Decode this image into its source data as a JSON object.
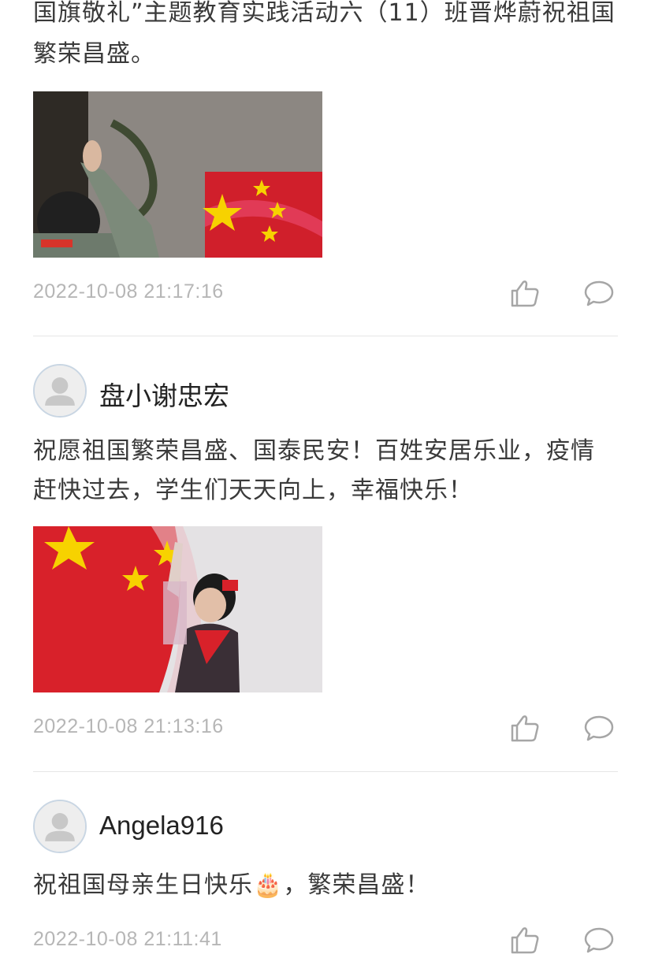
{
  "comments": [
    {
      "text_line1": "国旗敬礼”主题教育实践活动六（11）班晋烨蔚祝祖国",
      "text_line2": "繁荣昌盛。",
      "time": "2022-10-08 21:17:16",
      "photo_icon": "photo-boy-saluting-flag-screen"
    },
    {
      "author": "盘小谢忠宏",
      "text_line1": "祝愿祖国繁荣昌盛、国泰民安！百姓安居乐业，疫情",
      "text_line2": "赶快过去，学生们天天向上，幸福快乐！",
      "time": "2022-10-08 21:13:16",
      "photo_icon": "photo-boy-saluting-flag"
    },
    {
      "author": "Angela916",
      "text_line1": "祝祖国母亲生日快乐🎂，繁荣昌盛！",
      "time": "2022-10-08 21:11:41"
    }
  ],
  "icons": {
    "like": "thumbs-up-icon",
    "reply": "comment-bubble-icon",
    "avatar": "default-user-avatar"
  },
  "colors": {
    "timestamp": "#b6b6b6",
    "text": "#3a3a3a",
    "flag_red": "#d8212a",
    "star_yellow": "#f7d200"
  }
}
